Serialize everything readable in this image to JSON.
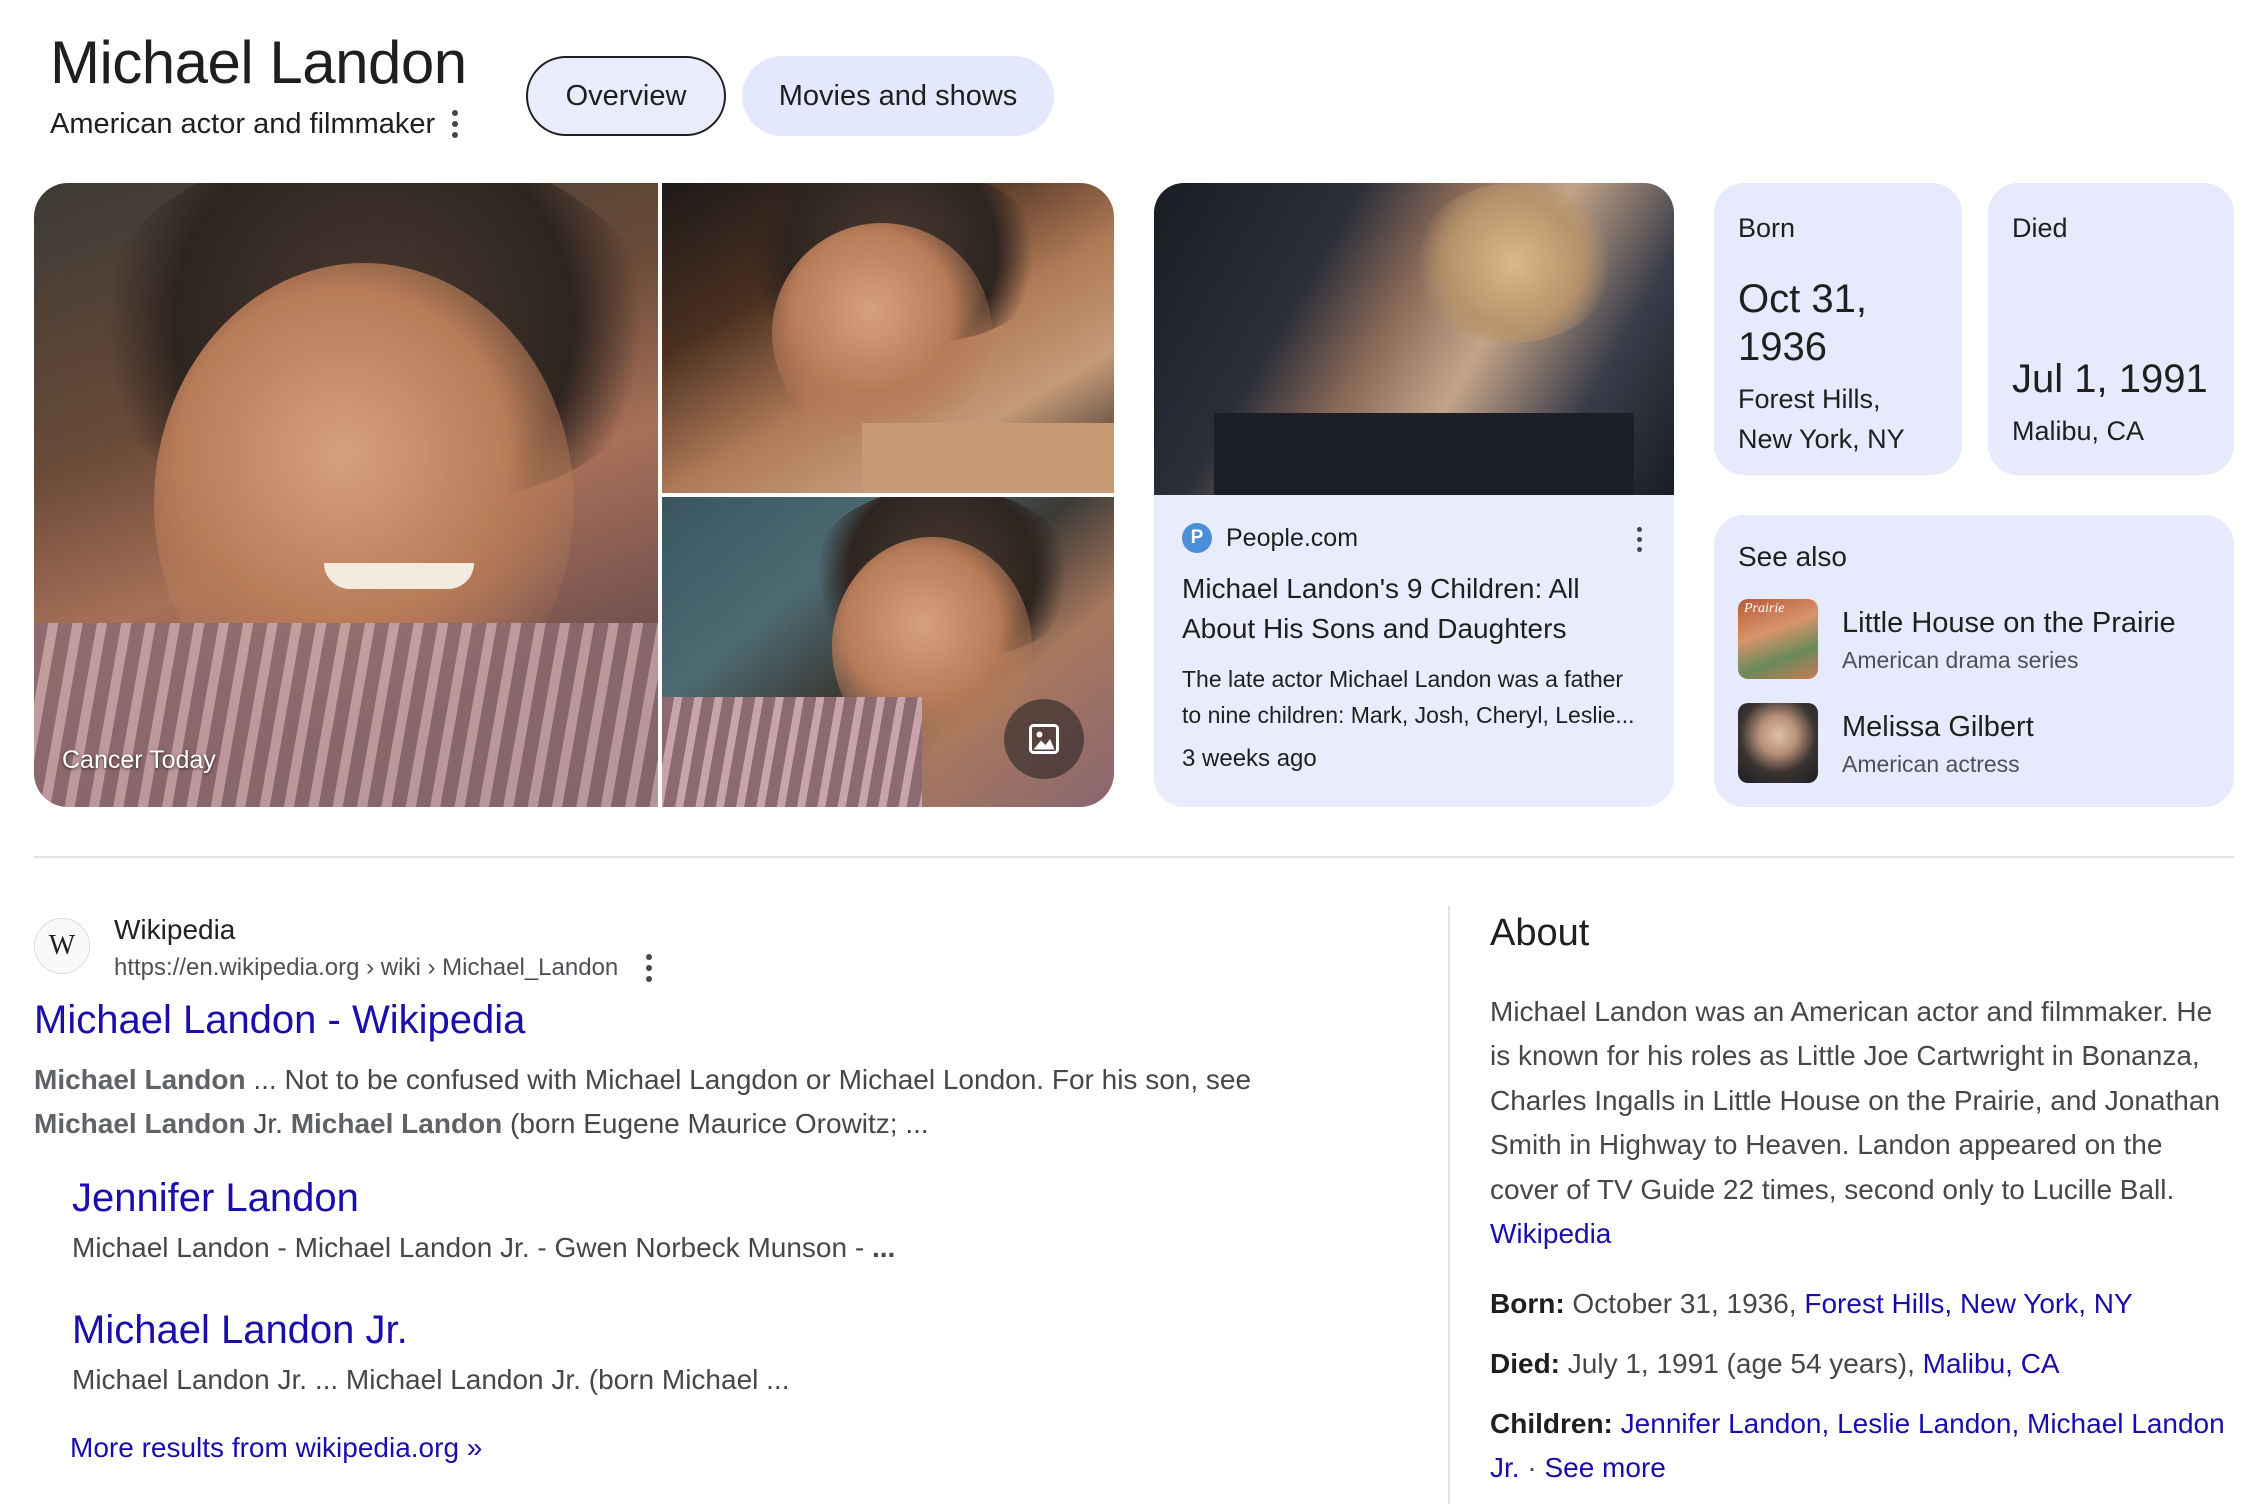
{
  "entity": {
    "title": "Michael Landon",
    "subtitle": "American actor and filmmaker"
  },
  "tabs": [
    {
      "label": "Overview",
      "active": true
    },
    {
      "label": "Movies and shows",
      "active": false
    }
  ],
  "images": {
    "caption": "Cancer Today"
  },
  "news": {
    "source": "People.com",
    "source_logo_letter": "P",
    "title": "Michael Landon's 9 Children: All About His Sons and Daughters",
    "snippet_line1": "The late actor Michael Landon was a father",
    "snippet_line2": "to nine children: Mark, Josh, Cheryl, Leslie...",
    "age": "3 weeks ago"
  },
  "born": {
    "label": "Born",
    "date_line1": "Oct 31,",
    "date_line2": "1936",
    "place_line1": "Forest Hills,",
    "place_line2": "New York, NY"
  },
  "died": {
    "label": "Died",
    "date": "Jul 1, 1991",
    "place": "Malibu, CA"
  },
  "see_also": {
    "title": "See also",
    "items": [
      {
        "name": "Little House on the Prairie",
        "description": "American drama series"
      },
      {
        "name": "Melissa Gilbert",
        "description": "American actress"
      }
    ]
  },
  "result": {
    "favicon_letter": "W",
    "site_name": "Wikipedia",
    "url": "https://en.wikipedia.org › wiki › Michael_Landon",
    "title": "Michael Landon - Wikipedia",
    "snippet": {
      "bold1": "Michael Landon",
      "text1": " ... Not to be confused with Michael Langdon or Michael London. For his son, see ",
      "bold2": "Michael Landon",
      "text2": " Jr. ",
      "bold3": "Michael Landon",
      "text3": " (born Eugene Maurice Orowitz; ..."
    },
    "sublinks": [
      {
        "title": "Jennifer Landon",
        "snippet": "Michael Landon - Michael Landon Jr. - Gwen Norbeck Munson - ",
        "snippet_bold": "..."
      },
      {
        "title": "Michael Landon Jr.",
        "snippet": "Michael Landon Jr. ... Michael Landon Jr. (born Michael ...",
        "snippet_bold": ""
      }
    ],
    "more": "More results from wikipedia.org »"
  },
  "about": {
    "heading": "About",
    "text": "Michael Landon was an American actor and filmmaker. He is known for his roles as Little Joe Cartwright in Bonanza, Charles Ingalls in Little House on the Prairie, and Jonathan Smith in Highway to Heaven. Landon appeared on the cover of TV Guide 22 times, second only to Lucille Ball.",
    "source": "Wikipedia",
    "born_label": "Born:",
    "born_text": " October 31, 1936, ",
    "born_link1": "Forest Hills",
    "born_sep": ", ",
    "born_link2": "New York, NY",
    "died_label": "Died:",
    "died_text": " July 1, 1991 (age 54 years), ",
    "died_link": "Malibu, CA",
    "children_label": "Children:",
    "children": [
      "Jennifer Landon",
      "Leslie Landon",
      "Michael Landon Jr."
    ],
    "children_sep": ", ",
    "see_more_sep": " · ",
    "see_more": "See more"
  },
  "colors": {
    "link": "#1a0dab",
    "chip_bg": "#e6eafc",
    "text": "#1f1f1f"
  },
  "icons": [
    "more-vert-icon",
    "images-icon",
    "people-logo",
    "wikipedia-logo"
  ]
}
